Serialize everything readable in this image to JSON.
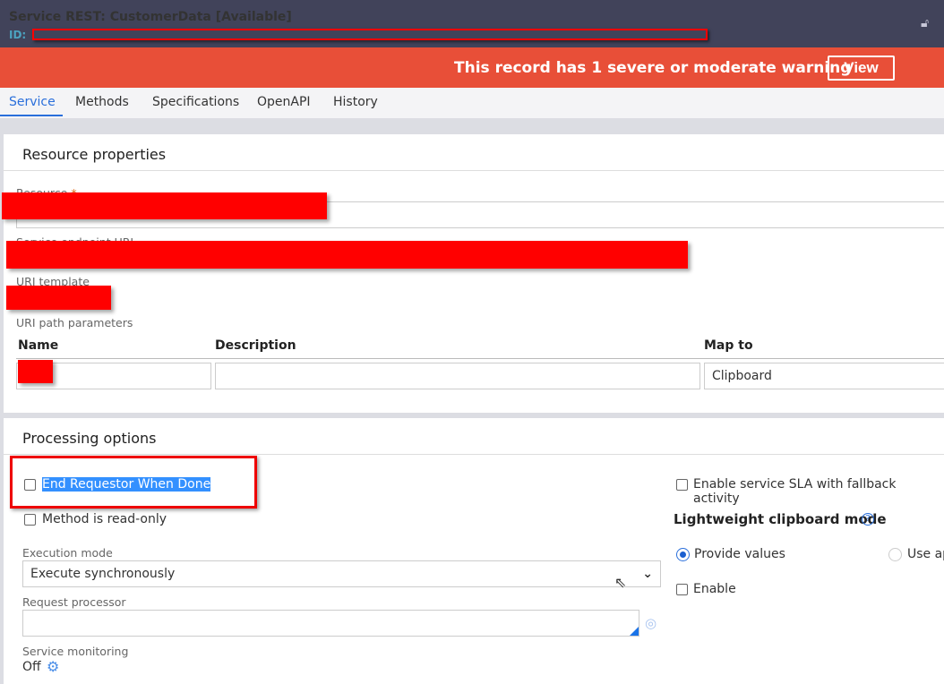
{
  "header": {
    "title": "Service REST: CustomerData",
    "status": "[Available]",
    "id_label": "ID:",
    "lock_icon": "lock-icon"
  },
  "warning": {
    "text": "This record has 1 severe or moderate warning",
    "view_label": "View"
  },
  "tabs": [
    {
      "label": "Service",
      "active": true
    },
    {
      "label": "Methods"
    },
    {
      "label": "Specifications"
    },
    {
      "label": "OpenAPI"
    },
    {
      "label": "History"
    }
  ],
  "resource": {
    "title": "Resource properties",
    "resource_label": "Resource",
    "required_mark": "*",
    "endpoint_label": "Service endpoint URL",
    "uri_template_label": "URI template",
    "uri_params_label": "URI path parameters",
    "columns": [
      "Name",
      "Description",
      "Map to"
    ],
    "row": {
      "map_to": "Clipboard"
    }
  },
  "processing": {
    "title": "Processing options",
    "end_requestor": "End Requestor When Done",
    "read_only": "Method is read-only",
    "execution_mode_label": "Execution mode",
    "execution_mode": "Execute synchronously",
    "request_processor_label": "Request processor",
    "service_monitoring_label": "Service monitoring",
    "service_monitoring": "Off",
    "sla": "Enable service SLA with fallback activity",
    "lightweight_title": "Lightweight clipboard mode",
    "provide_values": "Provide values",
    "use_ap": "Use ap",
    "enable": "Enable"
  }
}
